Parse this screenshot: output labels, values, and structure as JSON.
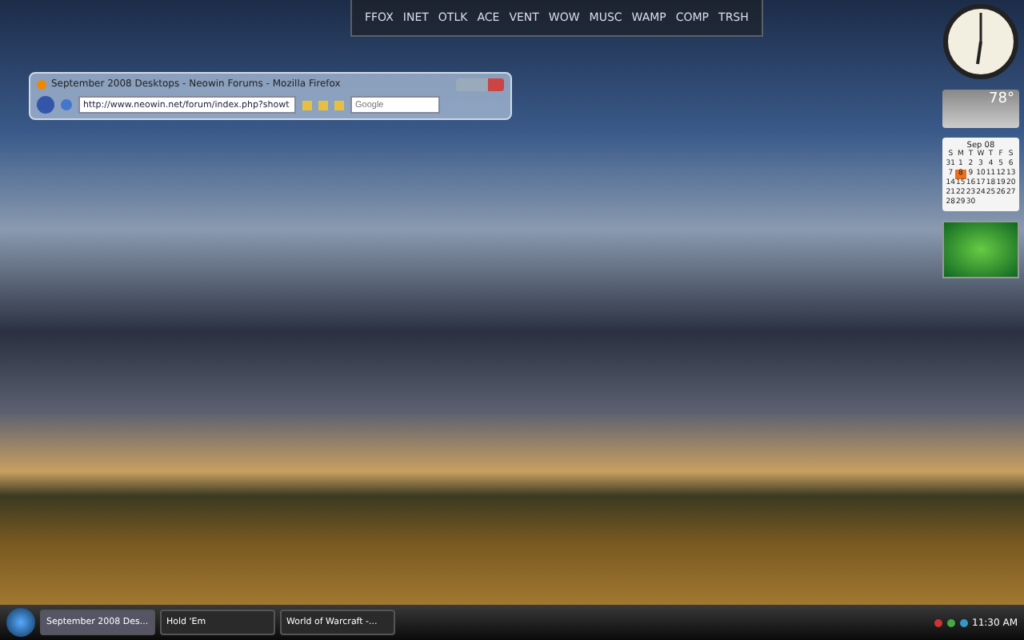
{
  "launcher": {
    "items": [
      {
        "label": "FFOX"
      },
      {
        "label": "INET"
      },
      {
        "label": "OTLK"
      },
      {
        "label": "ACE"
      },
      {
        "label": "VENT"
      },
      {
        "label": "WOW"
      },
      {
        "label": "MUSC"
      },
      {
        "label": "WAMP"
      },
      {
        "label": "COMP"
      },
      {
        "label": "TRSH"
      }
    ]
  },
  "browser": {
    "title": "September 2008 Desktops - Neowin Forums - Mozilla Firefox",
    "url": "http://www.neowin.net/forum/index.php?showt",
    "search": {
      "placeholder": "Google"
    }
  },
  "weather": {
    "temperature": "78°"
  },
  "calendar": {
    "month": "Sep 08",
    "weekdays": [
      "S",
      "M",
      "T",
      "W",
      "T",
      "F",
      "S"
    ],
    "days": [
      {
        "label": "31",
        "selected": false
      },
      {
        "label": "1",
        "selected": false
      },
      {
        "label": "2",
        "selected": false
      },
      {
        "label": "3",
        "selected": false
      },
      {
        "label": "4",
        "selected": false
      },
      {
        "label": "5",
        "selected": false
      },
      {
        "label": "6",
        "selected": false
      },
      {
        "label": "7",
        "selected": false
      },
      {
        "label": "8",
        "selected": true
      },
      {
        "label": "9",
        "selected": false
      },
      {
        "label": "10",
        "selected": false
      },
      {
        "label": "11",
        "selected": false
      },
      {
        "label": "12",
        "selected": false
      },
      {
        "label": "13",
        "selected": false
      },
      {
        "label": "14",
        "selected": false
      },
      {
        "label": "15",
        "selected": false
      },
      {
        "label": "16",
        "selected": false
      },
      {
        "label": "17",
        "selected": false
      },
      {
        "label": "18",
        "selected": false
      },
      {
        "label": "19",
        "selected": false
      },
      {
        "label": "20",
        "selected": false
      },
      {
        "label": "21",
        "selected": false
      },
      {
        "label": "22",
        "selected": false
      },
      {
        "label": "23",
        "selected": false
      },
      {
        "label": "24",
        "selected": false
      },
      {
        "label": "25",
        "selected": false
      },
      {
        "label": "26",
        "selected": false
      },
      {
        "label": "27",
        "selected": false
      },
      {
        "label": "28",
        "selected": false
      },
      {
        "label": "29",
        "selected": false
      },
      {
        "label": "30",
        "selected": false
      }
    ]
  },
  "taskbar": {
    "tasks": [
      {
        "label": "September 2008 Des...",
        "selected": true
      },
      {
        "label": "Hold 'Em",
        "selected": false
      },
      {
        "label": "World of Warcraft -...",
        "selected": false
      }
    ],
    "time": "11:30 AM"
  }
}
